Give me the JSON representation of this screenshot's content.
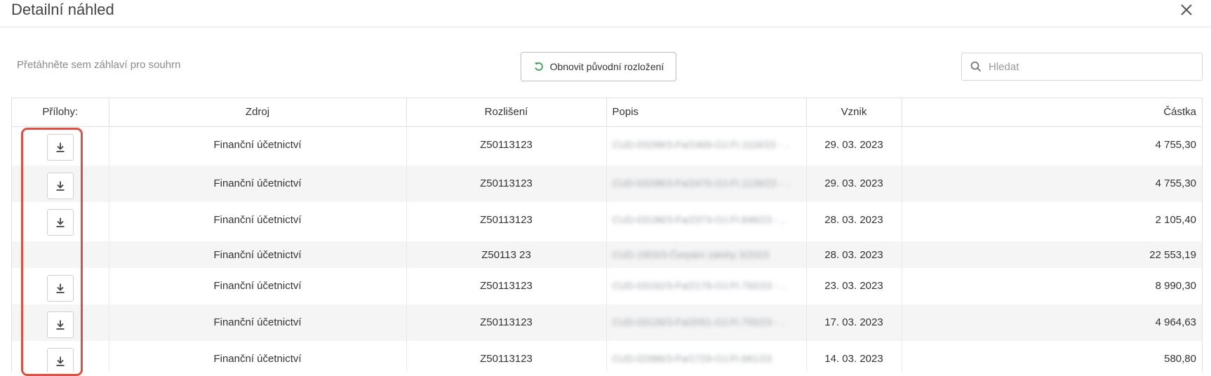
{
  "dialog": {
    "title": "Detailní náhled",
    "close_icon": "close-icon"
  },
  "toolbar": {
    "group_hint": "Přetáhněte sem záhlaví pro souhrn",
    "reset_label": "Obnovit původní rozložení",
    "reset_icon": "refresh-icon",
    "search_placeholder": "Hledat",
    "search_icon": "search-icon"
  },
  "colors": {
    "highlight": "#e04f3f",
    "reset_icon": "#3aa655",
    "row_alt": "#f5f5f5"
  },
  "table": {
    "columns": [
      "Přílohy:",
      "Zdroj",
      "Rozlišení",
      "Popis",
      "Vznik",
      "Částka"
    ],
    "rows": [
      {
        "has_attachment": true,
        "zdroj": "Finanční účetnictví",
        "rozliseni": "Z50113123",
        "popis": "CUD-03298/3-Fa/2469-OJ.FI.1116/23 - ..",
        "vznik": "29. 03. 2023",
        "castka": "4 755,30"
      },
      {
        "has_attachment": true,
        "zdroj": "Finanční účetnictví",
        "rozliseni": "Z50113123",
        "popis": "CUD-03298/3-Fa/2470-OJ.FI.1126/23 - ..",
        "vznik": "29. 03. 2023",
        "castka": "4 755,30"
      },
      {
        "has_attachment": true,
        "zdroj": "Finanční účetnictví",
        "rozliseni": "Z50113123",
        "popis": "CUD-03196/3-Fa/2373-OJ.FI.846/23 - ..",
        "vznik": "28. 03. 2023",
        "castka": "2 105,40"
      },
      {
        "has_attachment": false,
        "zdroj": "Finanční účetnictví",
        "rozliseni": "Z50113 23",
        "popis": "CUD-1903/3-Čerpání zálohy 3/2023",
        "vznik": "28. 03. 2023",
        "castka": "22 553,19"
      },
      {
        "has_attachment": true,
        "zdroj": "Finanční účetnictví",
        "rozliseni": "Z50113123",
        "popis": "CUD-03192/3-Fa/2179-OJ.FI.792/23 - ..",
        "vznik": "23. 03. 2023",
        "castka": "8 990,30"
      },
      {
        "has_attachment": true,
        "zdroj": "Finanční účetnictví",
        "rozliseni": "Z50113123",
        "popis": "CUD-03126/3-Fa/2051-OJ.FI.755/23 - ..",
        "vznik": "17. 03. 2023",
        "castka": "4 964,63"
      },
      {
        "has_attachment": true,
        "zdroj": "Finanční účetnictví",
        "rozliseni": "Z50113123",
        "popis": "CUD-02986/3-Fa/1729-OJ.FI.681/23",
        "vznik": "14. 03. 2023",
        "castka": "580,80"
      }
    ]
  }
}
